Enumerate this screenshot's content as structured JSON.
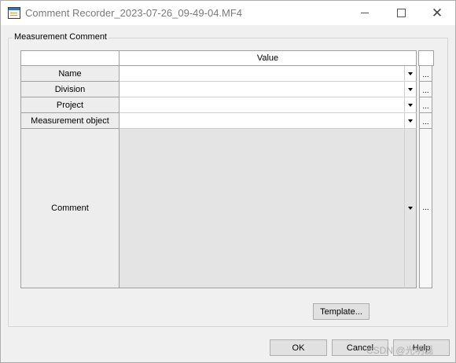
{
  "window": {
    "title": "Comment Recorder_2023-07-26_09-49-04.MF4",
    "icon": "app-window-icon",
    "controls": [
      "minimize-icon",
      "maximize-icon",
      "close-icon"
    ]
  },
  "group": {
    "label": "Measurement Comment"
  },
  "grid": {
    "column_header": "Value",
    "rows": [
      {
        "label": "Name",
        "value": "",
        "ellipsis": "..."
      },
      {
        "label": "Division",
        "value": "",
        "ellipsis": "..."
      },
      {
        "label": "Project",
        "value": "",
        "ellipsis": "..."
      },
      {
        "label": "Measurement object",
        "value": "",
        "ellipsis": "..."
      },
      {
        "label": "Comment",
        "value": "",
        "ellipsis": "..."
      }
    ]
  },
  "buttons": {
    "template": "Template...",
    "ok": "OK",
    "cancel": "Cancel",
    "help": "Help"
  },
  "watermark": "CSDN @光明磊"
}
